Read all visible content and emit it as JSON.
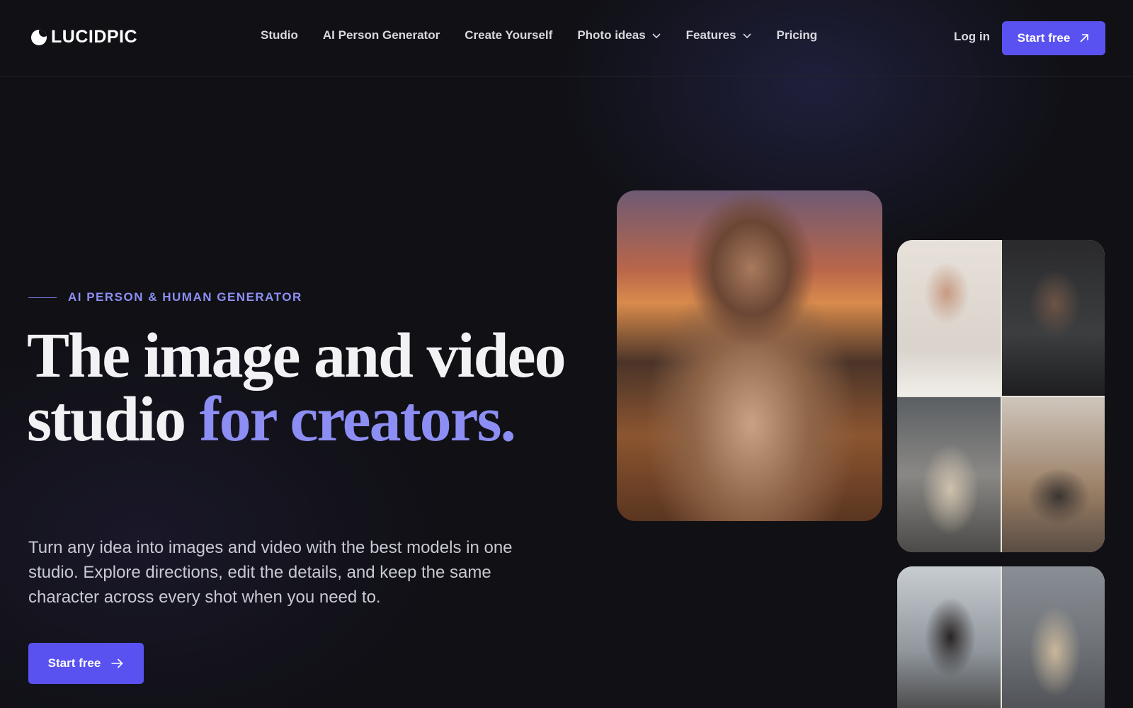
{
  "brand": {
    "name": "LUCIDPIC"
  },
  "nav": {
    "items": [
      {
        "label": "Studio",
        "has_dropdown": false
      },
      {
        "label": "AI Person Generator",
        "has_dropdown": false
      },
      {
        "label": "Create Yourself",
        "has_dropdown": false
      },
      {
        "label": "Photo ideas",
        "has_dropdown": true
      },
      {
        "label": "Features",
        "has_dropdown": true
      },
      {
        "label": "Pricing",
        "has_dropdown": false
      }
    ],
    "login_label": "Log in",
    "cta_label": "Start free"
  },
  "hero": {
    "eyebrow": "AI PERSON & HUMAN GENERATOR",
    "headline_part1": "The image and video studio ",
    "headline_accent": "for creators.",
    "description": "Turn any idea into images and video with the best models in one studio. Explore directions, edit the details, and keep the same character across every shot when you need to.",
    "cta_label": "Start free"
  },
  "colors": {
    "background": "#101015",
    "accent": "#5a52f0",
    "accent_text": "#8c8ef3"
  }
}
